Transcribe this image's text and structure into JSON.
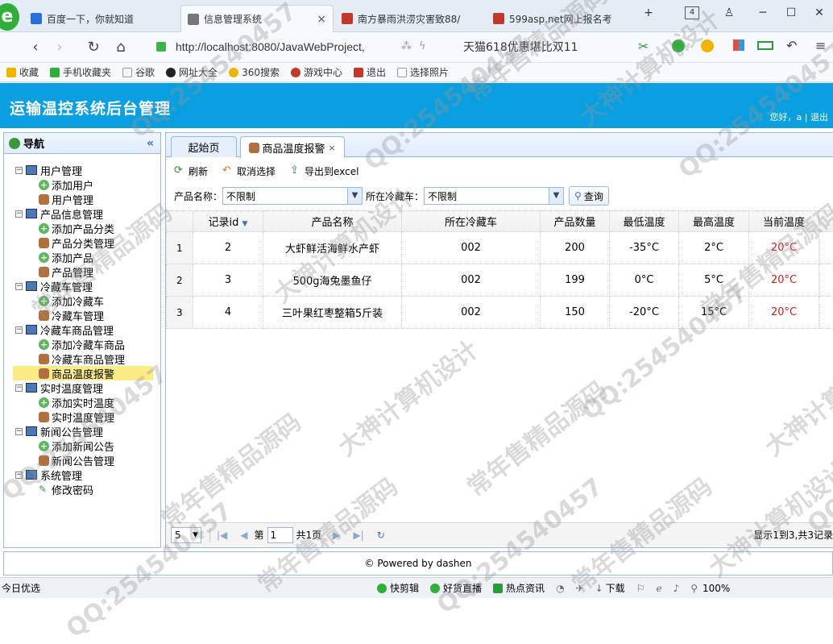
{
  "browser": {
    "tabs": [
      {
        "label": "百度一下，你就知道",
        "color": "#2a6fdb"
      },
      {
        "label": "信息管理系统",
        "color": "#777777"
      },
      {
        "label": "南方暴雨洪涝灾害致88/",
        "color": "#c0392b"
      },
      {
        "label": "599asp.net网上报名考",
        "color": "#c0392b"
      }
    ],
    "tab_count": "4",
    "url": "http://localhost:8080/JavaWebProject,",
    "search_text": "天猫618优惠堪比双11",
    "bookmarks": [
      "收藏",
      "手机收藏夹",
      "谷歌",
      "网址大全",
      "360搜索",
      "游戏中心",
      "退出",
      "选择照片"
    ]
  },
  "app": {
    "title": "运输温控系统后台管理",
    "greeting": "您好，a | 退出"
  },
  "nav": {
    "title": "导航",
    "groups": [
      {
        "label": "用户管理",
        "children": [
          {
            "label": "添加用户",
            "icon": "plus"
          },
          {
            "label": "用户管理",
            "icon": "user"
          }
        ]
      },
      {
        "label": "产品信息管理",
        "children": [
          {
            "label": "添加产品分类",
            "icon": "plus"
          },
          {
            "label": "产品分类管理",
            "icon": "user"
          },
          {
            "label": "添加产品",
            "icon": "plus"
          },
          {
            "label": "产品管理",
            "icon": "user"
          }
        ]
      },
      {
        "label": "冷藏车管理",
        "children": [
          {
            "label": "添加冷藏车",
            "icon": "plus"
          },
          {
            "label": "冷藏车管理",
            "icon": "user"
          }
        ]
      },
      {
        "label": "冷藏车商品管理",
        "children": [
          {
            "label": "添加冷藏车商品",
            "icon": "plus"
          },
          {
            "label": "冷藏车商品管理",
            "icon": "user"
          },
          {
            "label": "商品温度报警",
            "icon": "user",
            "selected": true
          }
        ]
      },
      {
        "label": "实时温度管理",
        "children": [
          {
            "label": "添加实时温度",
            "icon": "plus"
          },
          {
            "label": "实时温度管理",
            "icon": "user"
          }
        ]
      },
      {
        "label": "新闻公告管理",
        "children": [
          {
            "label": "添加新闻公告",
            "icon": "plus"
          },
          {
            "label": "新闻公告管理",
            "icon": "user"
          }
        ]
      },
      {
        "label": "系统管理",
        "children": [
          {
            "label": "修改密码",
            "icon": "pen"
          }
        ]
      }
    ]
  },
  "main": {
    "tabs": [
      {
        "label": "起始页"
      },
      {
        "label": "商品温度报警"
      }
    ],
    "toolbar": {
      "refresh": "刷新",
      "deselect": "取消选择",
      "export": "导出到excel"
    },
    "filter": {
      "product_label": "产品名称：",
      "product_value": "不限制",
      "truck_label": "所在冷藏车：",
      "truck_value": "不限制",
      "query": "查询"
    },
    "columns": [
      "记录id",
      "产品名称",
      "所在冷藏车",
      "产品数量",
      "最低温度",
      "最高温度",
      "当前温度"
    ],
    "rows": [
      [
        "1",
        "2",
        "大虾鲜活海鲜水产虾",
        "002",
        "200",
        "-35°C",
        "2°C",
        "20°C"
      ],
      [
        "2",
        "3",
        "500g海兔墨鱼仔",
        "002",
        "199",
        "0°C",
        "5°C",
        "20°C"
      ],
      [
        "3",
        "4",
        "三叶果红枣整箱5斤装",
        "002",
        "150",
        "-20°C",
        "15°C",
        "20°C"
      ]
    ],
    "pager": {
      "page_size": "5",
      "page_prefix": "第",
      "page_value": "1",
      "page_suffix": "共1页",
      "info": "显示1到3,共3记录"
    }
  },
  "footer": "© Powered by dashen",
  "statusbar": {
    "left": "今日优选",
    "items": [
      "快剪辑",
      "好货直播",
      "热点资讯",
      "下载"
    ],
    "zoom": "100%"
  },
  "watermark": [
    "常年售精品源码",
    "QQ:254540457",
    "大神计算机设计"
  ],
  "colors": {
    "header": "#0a9fe0",
    "alert": "#d61a1a",
    "selected": "#fbec88"
  }
}
